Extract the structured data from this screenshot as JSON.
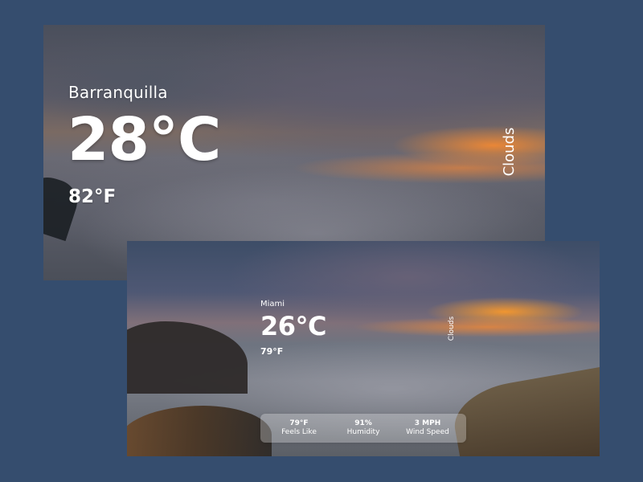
{
  "card_1": {
    "city": "Barranquilla",
    "temp_c": "28°C",
    "temp_f": "82°F",
    "condition": "Clouds"
  },
  "card_2": {
    "city": "Miami",
    "temp_c": "26°C",
    "temp_f": "79°F",
    "condition": "Clouds",
    "stats": [
      {
        "value": "79°F",
        "label": "Feels Like"
      },
      {
        "value": "91%",
        "label": "Humidity"
      },
      {
        "value": "3 MPH",
        "label": "Wind Speed"
      }
    ]
  }
}
